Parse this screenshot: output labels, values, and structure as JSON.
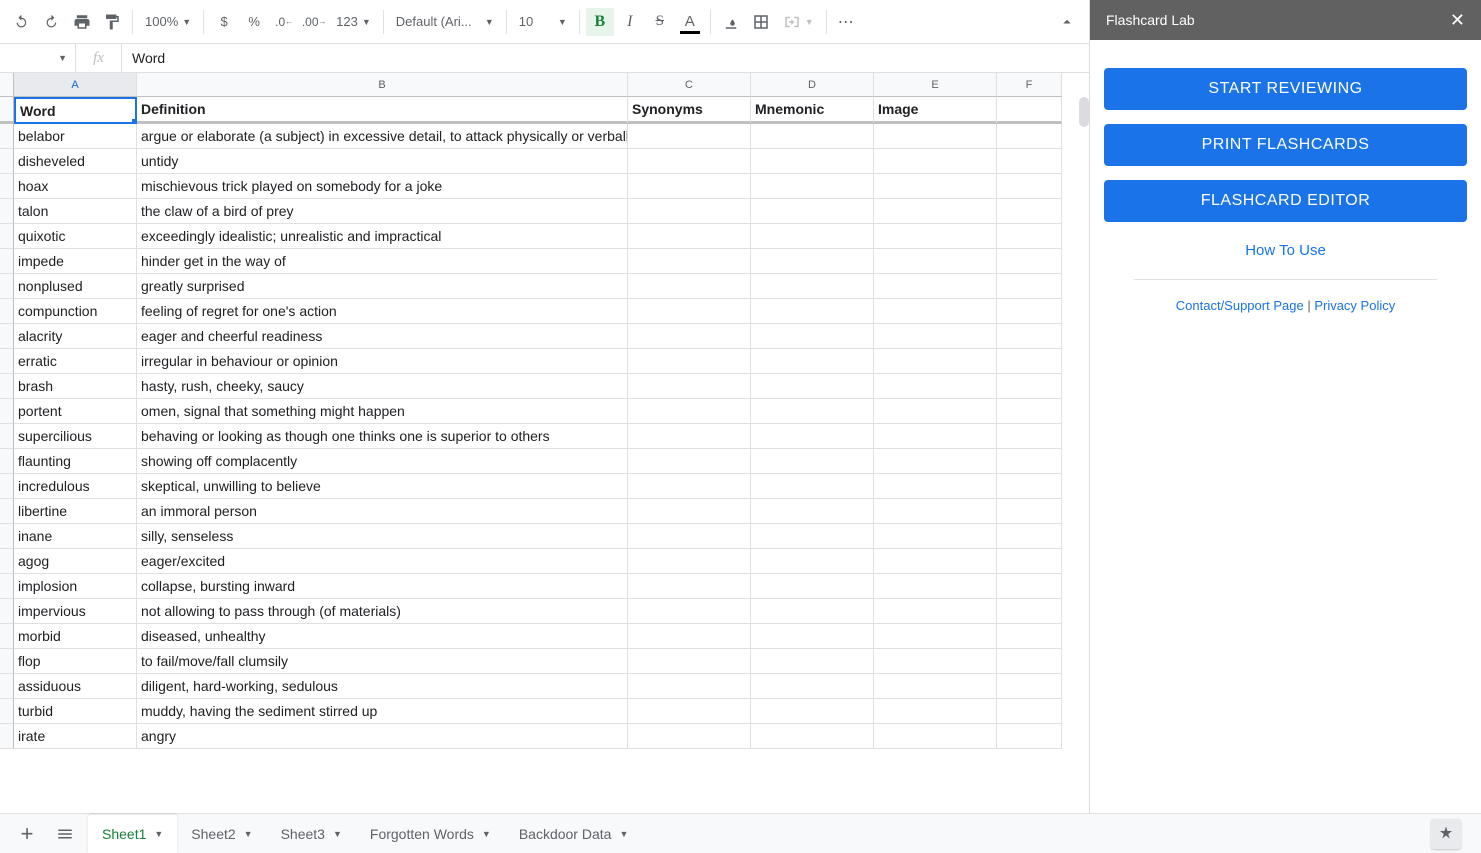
{
  "toolbar": {
    "zoom": "100%",
    "currency": "$",
    "percent": "%",
    "dec_dec": ".0",
    "inc_dec": ".00",
    "numfmt": "123",
    "font": "Default (Ari...",
    "font_size": "10",
    "bold": "B",
    "italic": "I",
    "strike": "S",
    "text_color": "A",
    "more": "⋯"
  },
  "formula": {
    "fx": "fx",
    "value": "Word"
  },
  "columns": [
    "A",
    "B",
    "C",
    "D",
    "E",
    "F"
  ],
  "headers": {
    "a": "Word",
    "b": "Definition",
    "c": "Synonyms",
    "d": "Mnemonic",
    "e": "Image"
  },
  "rows": [
    {
      "a": "belabor",
      "b": "argue or elaborate (a subject) in excessive detail, to attack physically or verbally"
    },
    {
      "a": "disheveled",
      "b": "untidy"
    },
    {
      "a": "hoax",
      "b": "mischievous trick played on somebody for a joke"
    },
    {
      "a": "talon",
      "b": "the claw of a bird of prey"
    },
    {
      "a": "quixotic",
      "b": "exceedingly idealistic; unrealistic and impractical"
    },
    {
      "a": "impede",
      "b": "hinder get in the way of"
    },
    {
      "a": "nonplused",
      "b": "greatly surprised"
    },
    {
      "a": "compunction",
      "b": "feeling of regret for one's action"
    },
    {
      "a": "alacrity",
      "b": "eager and cheerful readiness"
    },
    {
      "a": "erratic",
      "b": "irregular in behaviour or opinion"
    },
    {
      "a": "brash",
      "b": "hasty, rush, cheeky, saucy"
    },
    {
      "a": "portent",
      "b": "omen, signal that something might happen"
    },
    {
      "a": "supercilious",
      "b": "behaving or looking as though one thinks one is superior to others"
    },
    {
      "a": "flaunting",
      "b": "showing off complacently"
    },
    {
      "a": "incredulous",
      "b": "skeptical, unwilling to believe"
    },
    {
      "a": "libertine",
      "b": "an immoral person"
    },
    {
      "a": "inane",
      "b": "silly, senseless"
    },
    {
      "a": "agog",
      "b": "eager/excited"
    },
    {
      "a": "implosion",
      "b": "collapse, bursting inward"
    },
    {
      "a": "impervious",
      "b": "not allowing to pass through (of materials)"
    },
    {
      "a": "morbid",
      "b": "diseased, unhealthy"
    },
    {
      "a": "flop",
      "b": "to fail/move/fall clumsily"
    },
    {
      "a": "assiduous",
      "b": "diligent, hard-working, sedulous"
    },
    {
      "a": "turbid",
      "b": "muddy, having the sediment stirred up"
    },
    {
      "a": "irate",
      "b": "angry"
    }
  ],
  "sheets": [
    "Sheet1",
    "Sheet2",
    "Sheet3",
    "Forgotten Words",
    "Backdoor Data"
  ],
  "panel": {
    "title": "Flashcard Lab",
    "start": "START REVIEWING",
    "print": "PRINT FLASHCARDS",
    "editor": "FLASHCARD EDITOR",
    "howto": "How To Use",
    "contact": "Contact/Support Page",
    "privacy": "Privacy Policy"
  }
}
